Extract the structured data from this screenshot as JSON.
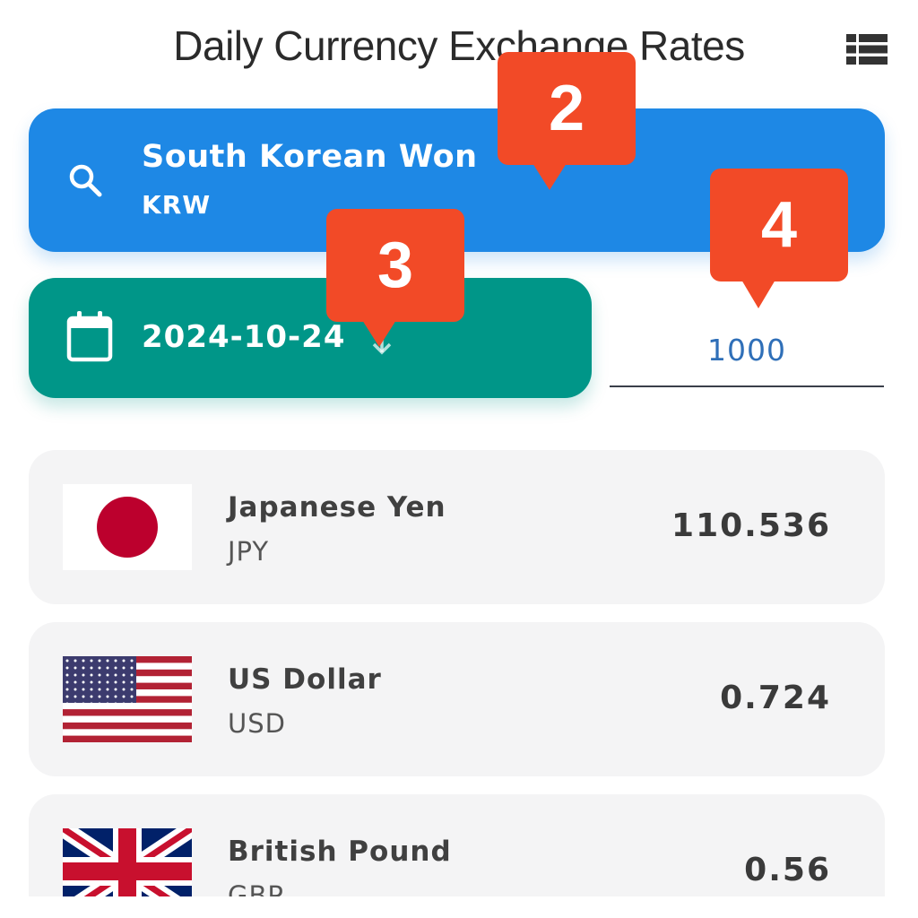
{
  "header": {
    "title": "Daily Currency Exchange Rates",
    "menu_icon": "list-icon"
  },
  "base_currency": {
    "name": "South Korean Won",
    "code": "KRW",
    "icon": "search-icon"
  },
  "date_selector": {
    "value": "2024-10-24",
    "icon": "calendar-icon"
  },
  "amount": {
    "value": "1000"
  },
  "rates": [
    {
      "name": "Japanese Yen",
      "code": "JPY",
      "value": "110.536"
    },
    {
      "name": "US Dollar",
      "code": "USD",
      "value": "0.724"
    },
    {
      "name": "British Pound",
      "code": "GBP",
      "value": "0.56"
    }
  ],
  "badges": [
    {
      "label": "2"
    },
    {
      "label": "3"
    },
    {
      "label": "4"
    }
  ],
  "colors": {
    "search_card": "#1e88e5",
    "date_card": "#009688",
    "badge": "#f24a27",
    "card_bg": "#f4f4f5",
    "amount_text": "#2f6fb8"
  }
}
